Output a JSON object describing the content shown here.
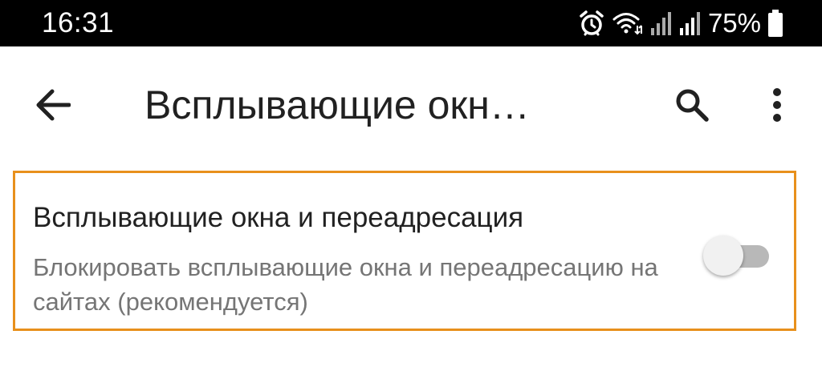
{
  "status_bar": {
    "time": "16:31",
    "battery_percent": "75%",
    "icons": [
      "alarm-icon",
      "wifi-icon",
      "signal-icon",
      "signal-icon",
      "battery-icon"
    ]
  },
  "toolbar": {
    "title": "Всплывающие окн…",
    "back_icon": "arrow-back-icon",
    "search_icon": "search-icon",
    "more_icon": "more-vert-icon"
  },
  "setting": {
    "title": "Всплывающие окна и переадресация",
    "summary": "Блокировать всплывающие окна и переадресацию на сайтах (рекомендуется)",
    "enabled": false
  },
  "colors": {
    "status_bar_bg": "#000000",
    "highlight_border": "#e8901c",
    "title_text": "#212121",
    "summary_text": "#757575"
  }
}
